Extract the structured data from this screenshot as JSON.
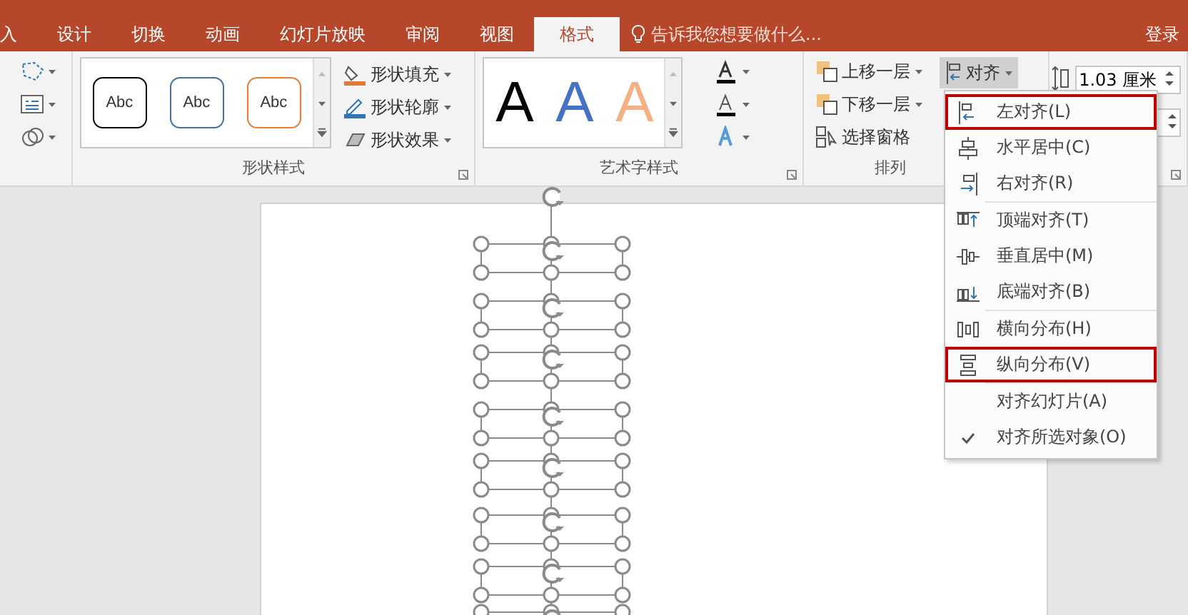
{
  "ribbon_tabs": [
    {
      "label": "入",
      "selected": false
    },
    {
      "label": "设计",
      "selected": false
    },
    {
      "label": "切换",
      "selected": false
    },
    {
      "label": "动画",
      "selected": false
    },
    {
      "label": "幻灯片放映",
      "selected": false
    },
    {
      "label": "审阅",
      "selected": false
    },
    {
      "label": "视图",
      "selected": false
    },
    {
      "label": "格式",
      "selected": true
    }
  ],
  "tell_me": {
    "placeholder": "告诉我您想要做什么..."
  },
  "sign_in": "登录",
  "shape_styles": {
    "label": "形状样式",
    "presets": [
      {
        "text": "Abc",
        "color": "#000000"
      },
      {
        "text": "Abc",
        "color": "#41719c"
      },
      {
        "text": "Abc",
        "color": "#ed7d31"
      }
    ],
    "commands": [
      "形状填充",
      "形状轮廓",
      "形状效果"
    ]
  },
  "wordart_styles": {
    "label": "艺术字样式",
    "presets": [
      {
        "text": "A",
        "color": "#000000"
      },
      {
        "text": "A",
        "color": "#4472c4"
      },
      {
        "text": "A",
        "color": "#f4b183"
      }
    ]
  },
  "arrange": {
    "label": "排列",
    "commands": [
      "上移一层",
      "下移一层",
      "选择窗格"
    ],
    "align_button": {
      "label": "对齐",
      "pressed": true
    }
  },
  "size": {
    "height_value": "1.03 厘米"
  },
  "align_menu": {
    "items": [
      {
        "kind": "left",
        "label": "左对齐(L)",
        "checked": false,
        "highlighted": true
      },
      {
        "kind": "center",
        "label": "水平居中(C)",
        "checked": false,
        "highlighted": false
      },
      {
        "kind": "right",
        "label": "右对齐(R)",
        "checked": false,
        "highlighted": false,
        "separator_after": true
      },
      {
        "kind": "top",
        "label": "顶端对齐(T)",
        "checked": false,
        "highlighted": false
      },
      {
        "kind": "middle",
        "label": "垂直居中(M)",
        "checked": false,
        "highlighted": false
      },
      {
        "kind": "bottom",
        "label": "底端对齐(B)",
        "checked": false,
        "highlighted": false,
        "separator_after": true
      },
      {
        "kind": "distribute-h",
        "label": "横向分布(H)",
        "checked": false,
        "highlighted": false
      },
      {
        "kind": "distribute-v",
        "label": "纵向分布(V)",
        "checked": false,
        "highlighted": true,
        "separator_after": true
      },
      {
        "kind": "none",
        "label": "对齐幻灯片(A)",
        "checked": false,
        "highlighted": false
      },
      {
        "kind": "none",
        "label": "对齐所选对象(O)",
        "checked": true,
        "highlighted": false
      }
    ]
  }
}
